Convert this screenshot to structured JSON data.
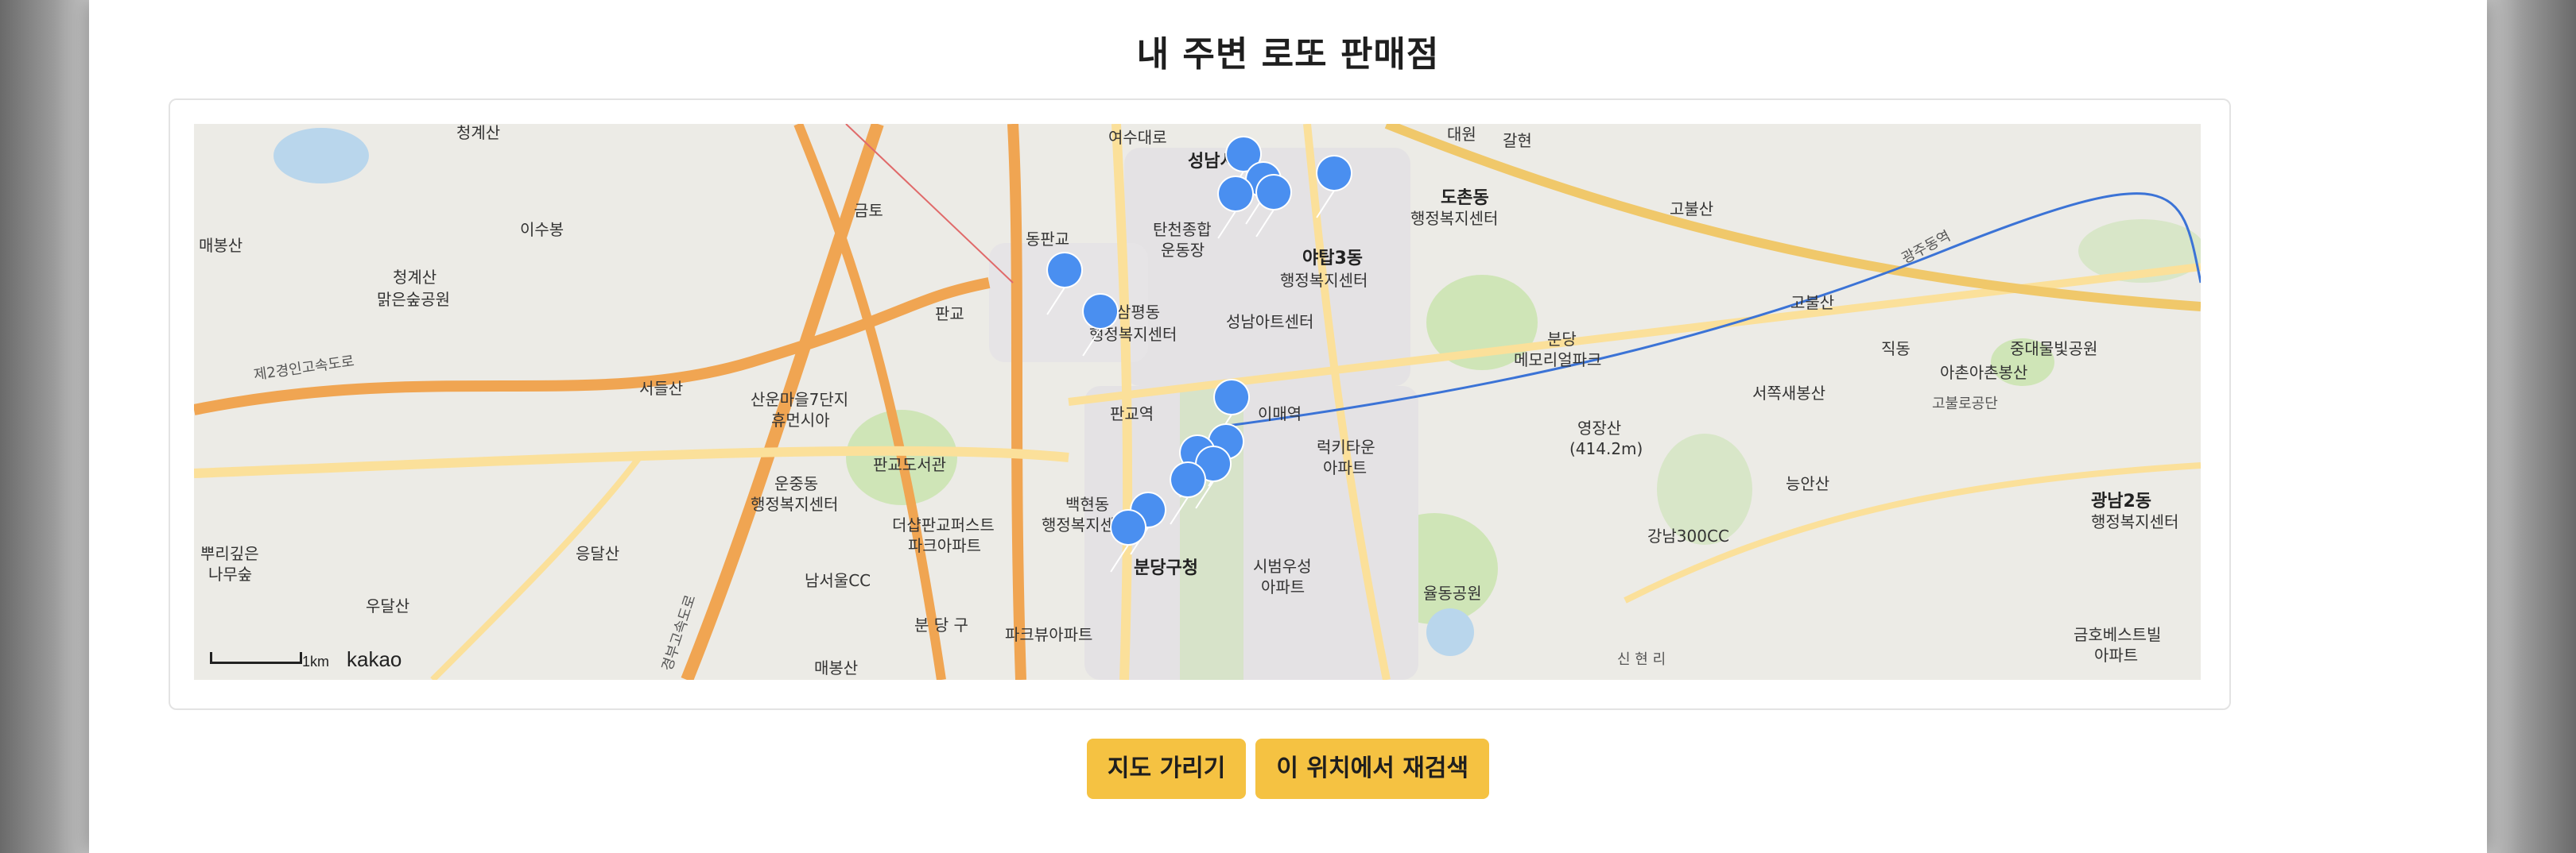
{
  "page": {
    "title": "내 주변 로또 판매점"
  },
  "map": {
    "scale_label": "1km",
    "provider": "kakao",
    "marker_icon": "map-pin-icon",
    "marker_color": "#4a8ff0",
    "labels": {
      "gyeonggye": "청계산",
      "yeosu": "여수대로",
      "seongnam": "성남시청",
      "daewon": "대원",
      "galhyeon": "갈현",
      "geumto": "금토",
      "isu": "이수봉",
      "maebong": "매봉산",
      "cheonggye_park": "청계산\n맑은숲공원",
      "dongpangyo": "동판교",
      "tancheon": "탄천종합\n운동장",
      "yatap3": "야탑3동\n행정복지센터",
      "dochon": "도촌동\n행정복지센터",
      "gobul": "고불산",
      "pangyo": "판교",
      "sampyeong": "삼평동\n행정복지센터",
      "seongnam_art": "성남아트센터",
      "bundang_memorial": "분당\n메모리얼파크",
      "gobul2": "고불산",
      "jikdong": "직동",
      "jungdae": "중대물빛공원",
      "road2": "제2경인고속도로",
      "seodeul": "서들산",
      "sanunmaeul": "산운마을7단지\n휴먼시아",
      "pangyo2": "판교",
      "pangyo_station": "판교역",
      "imae": "이매역",
      "yeongjang": "영장산\n(414.2m)",
      "seojok": "서쪽새봉산",
      "ahyeon": "아촌아촌봉산",
      "gobul_gongdan": "고불로공단",
      "unjung": "운중동\n행정복지센터",
      "pangyo_lib": "판교도서관",
      "baekhyeon": "백현동\n행정복지센터",
      "lucky": "럭키타운\n아파트",
      "neungan": "능안산",
      "gwangnam2": "광남2동\n행정복지센터",
      "puri": "뿌리깊은\n나무숲",
      "eungdal": "응달산",
      "deo_sharp": "더샵판교퍼스트\n파크아파트",
      "bundanggu": "분당구청",
      "sibeom": "시범우성\n아파트",
      "gangnam300": "강남300CC",
      "udal": "우달산",
      "namseoul": "남서울CC",
      "bundang_gu": "분 당 구",
      "park_view": "파크뷰아파트",
      "yuljeong": "율동공원",
      "geumho": "금호베스트빌\n아파트",
      "mae": "매봉산",
      "sinhyeon": "신 현 리",
      "gyeongbu": "경부고속도로",
      "gwangju": "광주동역"
    }
  },
  "buttons": {
    "hide_map": "지도 가리기",
    "research": "이 위치에서 재검색"
  },
  "colors": {
    "button_bg": "#f5c242",
    "highway": "#f0a552",
    "main_road": "#fbe09a"
  }
}
